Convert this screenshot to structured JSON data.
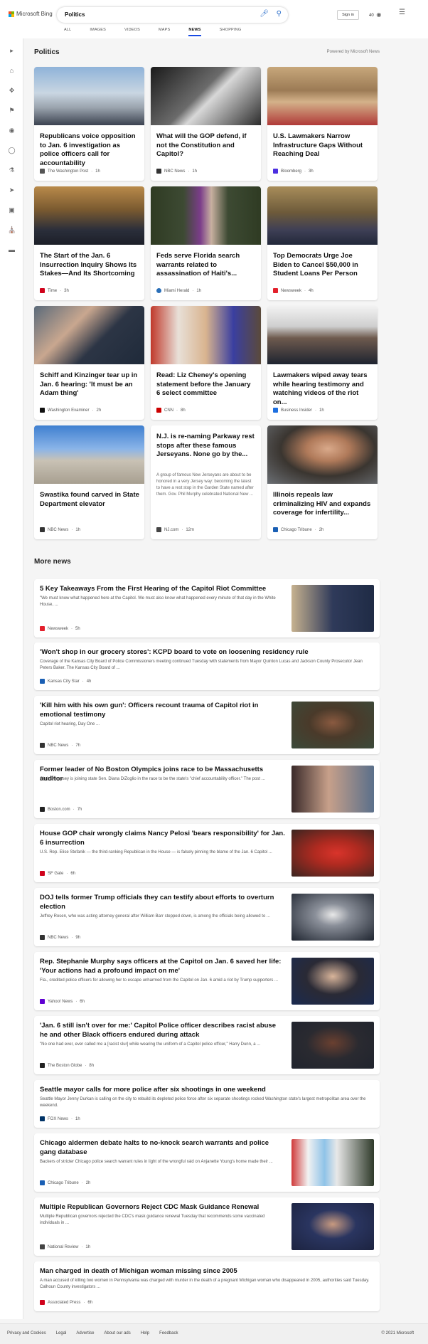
{
  "header": {
    "brand": "Microsoft Bing",
    "query": "Politics",
    "tabs": [
      {
        "label": "ALL",
        "active": false
      },
      {
        "label": "IMAGES",
        "active": false
      },
      {
        "label": "VIDEOS",
        "active": false
      },
      {
        "label": "MAPS",
        "active": false
      },
      {
        "label": "NEWS",
        "active": true
      },
      {
        "label": "SHOPPING",
        "active": false
      }
    ],
    "sign_in": "Sign in",
    "rewards_points": "40",
    "accent": "#174ae4"
  },
  "rail_icons": [
    "expand-arrow-icon",
    "home-icon",
    "discover-icon",
    "flag-icon",
    "location-icon",
    "world-icon",
    "science-icon",
    "rocket-icon",
    "entertainment-icon",
    "politics-icon",
    "money-icon"
  ],
  "section": {
    "title": "Politics",
    "powered_by": "Powered by Microsoft News"
  },
  "cards": [
    {
      "title": "Republicans voice opposition to Jan. 6 investigation as police officers call for accountability",
      "abstract": "",
      "source": "The Washington Post",
      "age": "1h"
    },
    {
      "title": "What will the GOP defend, if not the Constitution and Capitol?",
      "abstract": "",
      "source": "NBC News",
      "age": "1h"
    },
    {
      "title": "U.S. Lawmakers Narrow Infrastructure Gaps Without Reaching Deal",
      "abstract": "",
      "source": "Bloomberg",
      "age": "3h"
    },
    {
      "title": "The Start of the Jan. 6 Insurrection Inquiry Shows Its Stakes—And Its Shortcoming",
      "abstract": "",
      "source": "Time",
      "age": "3h"
    },
    {
      "title": "Feds serve Florida search warrants related to assassination of Haiti's...",
      "abstract": "",
      "source": "Miami Herald",
      "age": "1h"
    },
    {
      "title": "Top Democrats Urge Joe Biden to Cancel $50,000 in Student Loans Per Person",
      "abstract": "",
      "source": "Newsweek",
      "age": "4h"
    },
    {
      "title": "Schiff and Kinzinger tear up in Jan. 6 hearing: 'It must be an Adam thing'",
      "abstract": "",
      "source": "Washington Examiner",
      "age": "2h"
    },
    {
      "title": "Read: Liz Cheney's opening statement before the January 6 select committee",
      "abstract": "",
      "source": "CNN",
      "age": "8h"
    },
    {
      "title": "Lawmakers wiped away tears while hearing testimony and watching videos of the riot on...",
      "abstract": "",
      "source": "Business Insider",
      "age": "1h"
    },
    {
      "title": "Swastika found carved in State Department elevator",
      "abstract": "",
      "source": "NBC News",
      "age": "1h"
    },
    {
      "title": "N.J. is re-naming Parkway rest stops after these famous Jerseyans. None go by the...",
      "abstract": "A group of famous New Jerseyans are about to be honored in a very Jersey way: becoming the latest to have a rest stop in the Garden State named after them. Gov. Phil Murphy celebrated National New ...",
      "source": "NJ.com",
      "age": "12m"
    },
    {
      "title": "Illinois repeals law criminalizing HIV and expands coverage for infertility...",
      "abstract": "",
      "source": "Chicago Tribune",
      "age": "2h"
    }
  ],
  "more_news": {
    "title": "More news",
    "items": [
      {
        "title": "5 Key Takeaways From the First Hearing of the Capitol Riot Committee",
        "desc": "\"We must know what happened here at the Capitol. We must also know what happened every minute of that day in the White House, ...",
        "source": "Newsweek",
        "age": "5h"
      },
      {
        "title": "'Won't shop in our grocery stores': KCPD board to vote on loosening residency rule",
        "desc": "Coverage of the Kansas City Board of Police Commissioners meeting continued Tuesday with statements from Mayor Quinton Lucas and Jackson County Prosecutor Jean Peters Baker. The Kansas City Board of ...",
        "source": "Kansas City Star",
        "age": "4h"
      },
      {
        "title": "'Kill him with his own gun': Officers recount trauma of Capitol riot in emotional testimony",
        "desc": "Capitol riot hearing, Day One ...",
        "source": "NBC News",
        "age": "7h"
      },
      {
        "title": "Former leader of No Boston Olympics joins race to be Massachusetts auditor",
        "desc": "Chris Dempsey is joining state Sen. Diana DiZoglio in the race to be the state's \"chief accountability officer.\" The post ...",
        "source": "Boston.com",
        "age": "7h"
      },
      {
        "title": "House GOP chair wrongly claims Nancy Pelosi 'bears responsibility' for Jan. 6 insurrection",
        "desc": "U.S. Rep. Elise Stefanik — the third-ranking Republican in the House — is falsely pinning the blame of the Jan. 6 Capitol ...",
        "source": "SF Gate",
        "age": "6h"
      },
      {
        "title": "DOJ tells former Trump officials they can testify about efforts to overturn election",
        "desc": "Jeffrey Rosen, who was acting attorney general after William Barr stepped down, is among the officials being allowed to ...",
        "source": "NBC News",
        "age": "9h"
      },
      {
        "title": "Rep. Stephanie Murphy says officers at the Capitol on Jan. 6 saved her life: 'Your actions had a profound impact on me'",
        "desc": "Fla., credited police officers for allowing her to escape unharmed from the Capitol on Jan. 6 amid a riot by Trump supporters ...",
        "source": "Yahoo! News",
        "age": "6h"
      },
      {
        "title": "'Jan. 6 still isn't over for me:' Capitol Police officer describes racist abuse he and other Black officers endured during attack",
        "desc": "\"No one had ever, ever called me a [racist slur] while wearing the uniform of a Capitol police officer,\" Harry Dunn, a ...",
        "source": "The Boston Globe",
        "age": "8h"
      },
      {
        "title": "Seattle mayor calls for more police after six shootings in one weekend",
        "desc": "Seattle Mayor Jenny Durkan is calling on the city to rebuild its depleted police force after six separate shootings rocked Washington state's largest metropolitan area over the weekend.",
        "source": "FOX News",
        "age": "1h"
      },
      {
        "title": "Chicago aldermen debate halts to no-knock search warrants and police gang database",
        "desc": "Backers of stricter Chicago police search warrant rules in light of the wrongful raid on Anjanette Young's home made their ...",
        "source": "Chicago Tribune",
        "age": "2h"
      },
      {
        "title": "Multiple Republican Governors Reject CDC Mask Guidance Renewal",
        "desc": "Multiple Republican governors rejected the CDC's mask guidance renewal Tuesday that recommends some vaccinated individuals in ...",
        "source": "National Review",
        "age": "1h"
      },
      {
        "title": "Man charged in death of Michigan woman missing since 2005",
        "desc": "A man accused of killing two women in Pennsylvania was charged with murder in the death of a pregnant Michigan woman who disappeared in 2005, authorities said Tuesday. Calhoun County investigators ...",
        "source": "Associated Press",
        "age": "6h"
      }
    ]
  },
  "footer": {
    "links": [
      "Privacy and Cookies",
      "Legal",
      "Advertise",
      "About our ads",
      "Help",
      "Feedback"
    ],
    "copyright": "© 2021 Microsoft"
  }
}
